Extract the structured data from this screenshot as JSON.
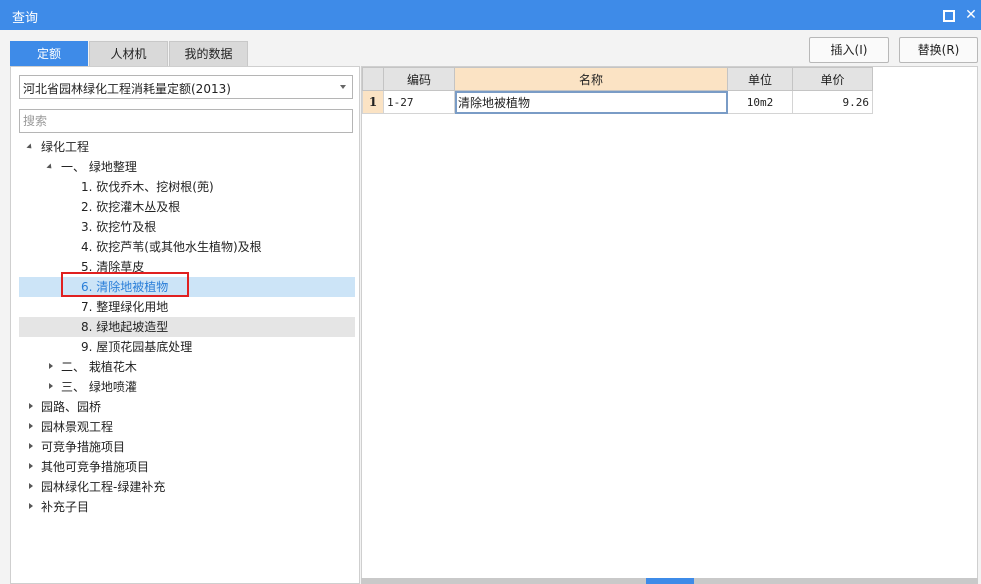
{
  "window": {
    "title": "查询",
    "max_icon": "maximize-icon",
    "close_icon": "close-icon",
    "close_glyph": "✕"
  },
  "tabs": [
    {
      "label": "定额",
      "active": true
    },
    {
      "label": "人材机",
      "active": false
    },
    {
      "label": "我的数据",
      "active": false
    }
  ],
  "toolbar": {
    "insert_label": "插入(I)",
    "replace_label": "替换(R)"
  },
  "left": {
    "quota_select": "河北省园林绿化工程消耗量定额(2013)",
    "search_placeholder": "搜索",
    "tree": [
      {
        "label": "绿化工程",
        "level": 0,
        "state": "expanded"
      },
      {
        "label": "一、 绿地整理",
        "level": 1,
        "state": "expanded"
      },
      {
        "label": "1. 砍伐乔木、挖树根(蔸)",
        "level": 2,
        "state": "leaf"
      },
      {
        "label": "2. 砍挖灌木丛及根",
        "level": 2,
        "state": "leaf"
      },
      {
        "label": "3. 砍挖竹及根",
        "level": 2,
        "state": "leaf"
      },
      {
        "label": "4. 砍挖芦苇(或其他水生植物)及根",
        "level": 2,
        "state": "leaf"
      },
      {
        "label": "5. 清除草皮",
        "level": 2,
        "state": "leaf"
      },
      {
        "label": "6. 清除地被植物",
        "level": 2,
        "state": "leaf",
        "selected": true
      },
      {
        "label": "7. 整理绿化用地",
        "level": 2,
        "state": "leaf"
      },
      {
        "label": "8. 绿地起坡造型",
        "level": 2,
        "state": "leaf",
        "hover": true
      },
      {
        "label": "9. 屋顶花园基底处理",
        "level": 2,
        "state": "leaf"
      },
      {
        "label": "二、 栽植花木",
        "level": 1,
        "state": "collapsed"
      },
      {
        "label": "三、 绿地喷灌",
        "level": 1,
        "state": "collapsed"
      },
      {
        "label": "园路、园桥",
        "level": 0,
        "state": "collapsed"
      },
      {
        "label": "园林景观工程",
        "level": 0,
        "state": "collapsed"
      },
      {
        "label": "可竞争措施项目",
        "level": 0,
        "state": "collapsed"
      },
      {
        "label": "其他可竞争措施项目",
        "level": 0,
        "state": "collapsed"
      },
      {
        "label": "园林绿化工程-绿建补充",
        "level": 0,
        "state": "collapsed"
      },
      {
        "label": "补充子目",
        "level": 0,
        "state": "collapsed"
      }
    ]
  },
  "grid": {
    "columns": [
      "编码",
      "名称",
      "单位",
      "单价"
    ],
    "rows": [
      {
        "index": "1",
        "code": "1-27",
        "name": "清除地被植物",
        "unit": "10m2",
        "price": "9.26"
      }
    ]
  },
  "colors": {
    "accent": "#3e8be8",
    "selection_bg": "#cce4f7",
    "highlight_border": "#e02020",
    "header_selected": "#fbe3c4"
  }
}
